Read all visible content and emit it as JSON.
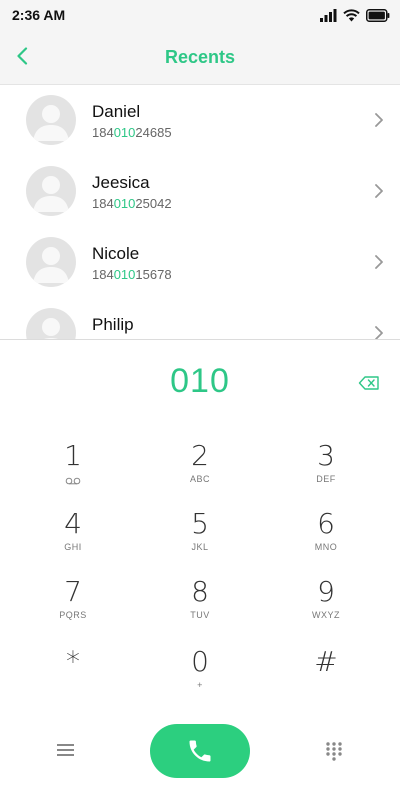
{
  "status": {
    "time": "2:36 AM"
  },
  "header": {
    "title": "Recents"
  },
  "contacts": [
    {
      "name": "Daniel",
      "number_pre": "184",
      "number_match": "010",
      "number_post": "24685"
    },
    {
      "name": "Jeesica",
      "number_pre": "184",
      "number_match": "010",
      "number_post": "25042"
    },
    {
      "name": "Nicole",
      "number_pre": "184",
      "number_match": "010",
      "number_post": "15678"
    },
    {
      "name": "Philip",
      "number_pre": "",
      "number_match": "",
      "number_post": ""
    }
  ],
  "dialer": {
    "input": "010",
    "keys": [
      {
        "digit": "1",
        "letters": ""
      },
      {
        "digit": "2",
        "letters": "ABC"
      },
      {
        "digit": "3",
        "letters": "DEF"
      },
      {
        "digit": "4",
        "letters": "GHI"
      },
      {
        "digit": "5",
        "letters": "JKL"
      },
      {
        "digit": "6",
        "letters": "MNO"
      },
      {
        "digit": "7",
        "letters": "PQRS"
      },
      {
        "digit": "8",
        "letters": "TUV"
      },
      {
        "digit": "9",
        "letters": "WXYZ"
      },
      {
        "digit": "*",
        "letters": ""
      },
      {
        "digit": "0",
        "letters": "+"
      },
      {
        "digit": "#",
        "letters": ""
      }
    ]
  },
  "colors": {
    "accent": "#2ec787",
    "call": "#2ccf7f"
  },
  "icons": [
    "back-chevron-icon",
    "chevron-right-icon",
    "backspace-icon",
    "voicemail-icon",
    "menu-icon",
    "phone-icon",
    "dialpad-icon",
    "signal-icon",
    "wifi-icon",
    "battery-icon"
  ]
}
